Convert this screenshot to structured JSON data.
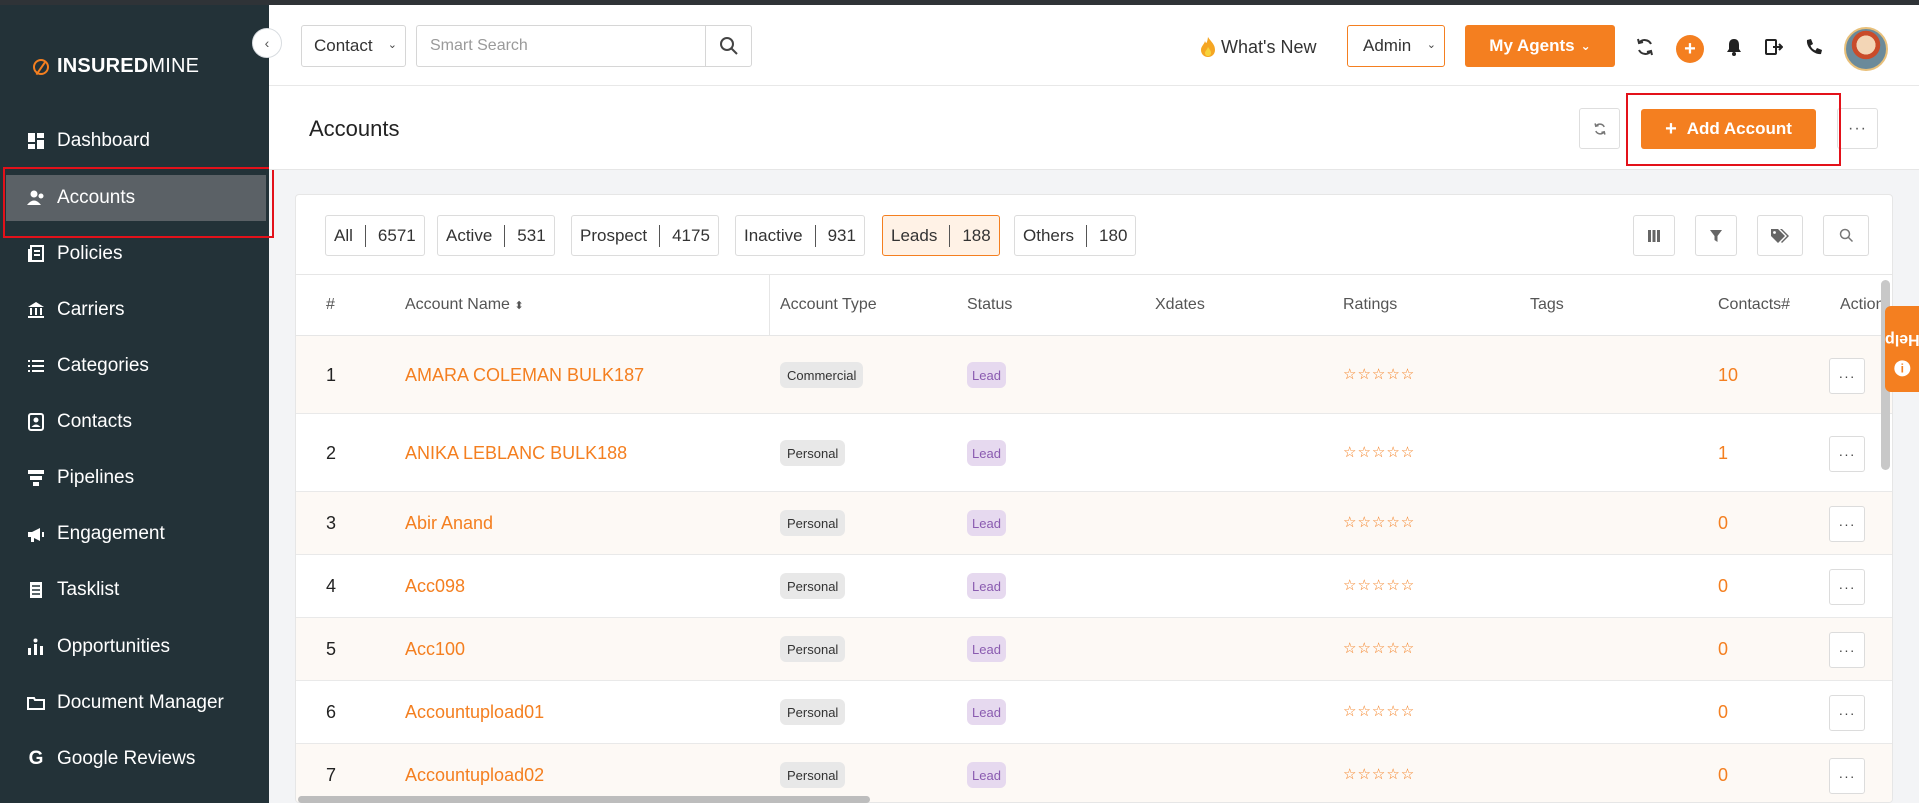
{
  "brand": {
    "name_bold": "INSURED",
    "name_rest": "MINE"
  },
  "sidebar": {
    "items": [
      {
        "label": "Dashboard",
        "icon": "dashboard-icon"
      },
      {
        "label": "Accounts",
        "icon": "accounts-icon",
        "active": true
      },
      {
        "label": "Policies",
        "icon": "policies-icon"
      },
      {
        "label": "Carriers",
        "icon": "carriers-icon"
      },
      {
        "label": "Categories",
        "icon": "categories-icon"
      },
      {
        "label": "Contacts",
        "icon": "contacts-icon"
      },
      {
        "label": "Pipelines",
        "icon": "pipelines-icon"
      },
      {
        "label": "Engagement",
        "icon": "engagement-icon"
      },
      {
        "label": "Tasklist",
        "icon": "tasklist-icon"
      },
      {
        "label": "Opportunities",
        "icon": "opportunities-icon"
      },
      {
        "label": "Document Manager",
        "icon": "document-manager-icon"
      },
      {
        "label": "Google Reviews",
        "icon": "google-icon"
      }
    ]
  },
  "topbar": {
    "search_scope": "Contact",
    "search_placeholder": "Smart Search",
    "whats_new": "What's New",
    "role": "Admin",
    "my_agents": "My Agents"
  },
  "header": {
    "title": "Accounts",
    "add_account": "Add Account"
  },
  "filters": [
    {
      "label": "All",
      "count": "6571"
    },
    {
      "label": "Active",
      "count": "531"
    },
    {
      "label": "Prospect",
      "count": "4175"
    },
    {
      "label": "Inactive",
      "count": "931"
    },
    {
      "label": "Leads",
      "count": "188",
      "active": true
    },
    {
      "label": "Others",
      "count": "180"
    }
  ],
  "table": {
    "columns": [
      "#",
      "Account Name",
      "Account Type",
      "Status",
      "Xdates",
      "Ratings",
      "Tags",
      "Contacts#",
      "Action"
    ],
    "rows": [
      {
        "num": "1",
        "name": "AMARA COLEMAN BULK187",
        "type": "Commercial",
        "status": "Lead",
        "rating": "☆☆☆☆☆",
        "contacts": "10"
      },
      {
        "num": "2",
        "name": "ANIKA LEBLANC BULK188",
        "type": "Personal",
        "status": "Lead",
        "rating": "☆☆☆☆☆",
        "contacts": "1"
      },
      {
        "num": "3",
        "name": "Abir Anand",
        "type": "Personal",
        "status": "Lead",
        "rating": "☆☆☆☆☆",
        "contacts": "0"
      },
      {
        "num": "4",
        "name": "Acc098",
        "type": "Personal",
        "status": "Lead",
        "rating": "☆☆☆☆☆",
        "contacts": "0"
      },
      {
        "num": "5",
        "name": "Acc100",
        "type": "Personal",
        "status": "Lead",
        "rating": "☆☆☆☆☆",
        "contacts": "0"
      },
      {
        "num": "6",
        "name": "Accountupload01",
        "type": "Personal",
        "status": "Lead",
        "rating": "☆☆☆☆☆",
        "contacts": "0"
      },
      {
        "num": "7",
        "name": "Accountupload02",
        "type": "Personal",
        "status": "Lead",
        "rating": "☆☆☆☆☆",
        "contacts": "0"
      }
    ]
  },
  "help": {
    "label": "Help"
  },
  "colors": {
    "accent": "#f47f20",
    "sidebar": "#233238",
    "highlight": "#e3111a"
  }
}
